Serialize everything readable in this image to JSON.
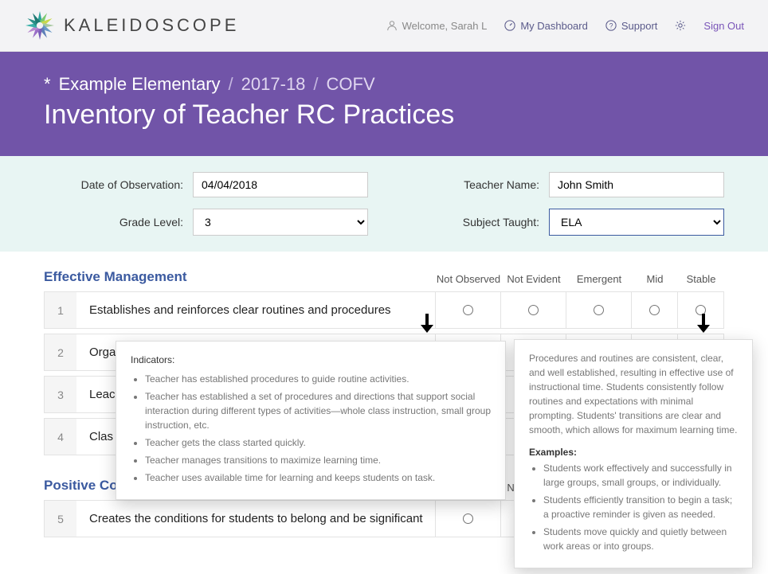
{
  "nav": {
    "brand": "KALEIDOSCOPE",
    "welcome": "Welcome, Sarah L",
    "dashboard": "My Dashboard",
    "support": "Support",
    "signout": "Sign Out"
  },
  "hero": {
    "site_prefix": "*",
    "site": "Example Elementary",
    "year": "2017-18",
    "code": "COFV",
    "title": "Inventory of Teacher RC Practices"
  },
  "form": {
    "date_label": "Date of Observation:",
    "date_value": "04/04/2018",
    "teacher_label": "Teacher Name:",
    "teacher_value": "John Smith",
    "grade_label": "Grade Level:",
    "grade_value": "3",
    "subject_label": "Subject Taught:",
    "subject_value": "ELA"
  },
  "columns": {
    "c0": "Not Observed",
    "c1": "Not Evident",
    "c2": "Emergent",
    "c3": "Mid",
    "c4": "Stable"
  },
  "sections": [
    {
      "title": "Effective Management",
      "items": [
        {
          "num": "1",
          "label": "Establishes and reinforces clear routines and procedures"
        },
        {
          "num": "2",
          "label": "Orga"
        },
        {
          "num": "3",
          "label": "Leac"
        },
        {
          "num": "4",
          "label": "Clas"
        }
      ]
    },
    {
      "title": "Positive Community",
      "items": [
        {
          "num": "5",
          "label": "Creates the conditions for students to belong and be significant"
        }
      ]
    }
  ],
  "popover_left": {
    "title": "Indicators:",
    "bullets": [
      "Teacher has established procedures to guide routine activities.",
      "Teacher has established a set of procedures and directions that support social interaction during different types of activities—whole class instruction, small group instruction, etc.",
      "Teacher gets the class started quickly.",
      "Teacher manages transitions to maximize learning time.",
      "Teacher uses available time for learning and keeps students on task."
    ]
  },
  "popover_right": {
    "body": "Procedures and routines are consistent, clear, and well established, resulting in effective use of instructional time. Students consistently follow routines and expectations with minimal prompting. Students' transitions are clear and smooth, which allows for maximum learning time.",
    "examples_title": "Examples:",
    "examples": [
      "Students work effectively and successfully in large groups, small groups, or individually.",
      "Students efficiently transition to begin a task; a proactive reminder is given as needed.",
      "Students move quickly and quietly between work areas or into groups."
    ]
  }
}
